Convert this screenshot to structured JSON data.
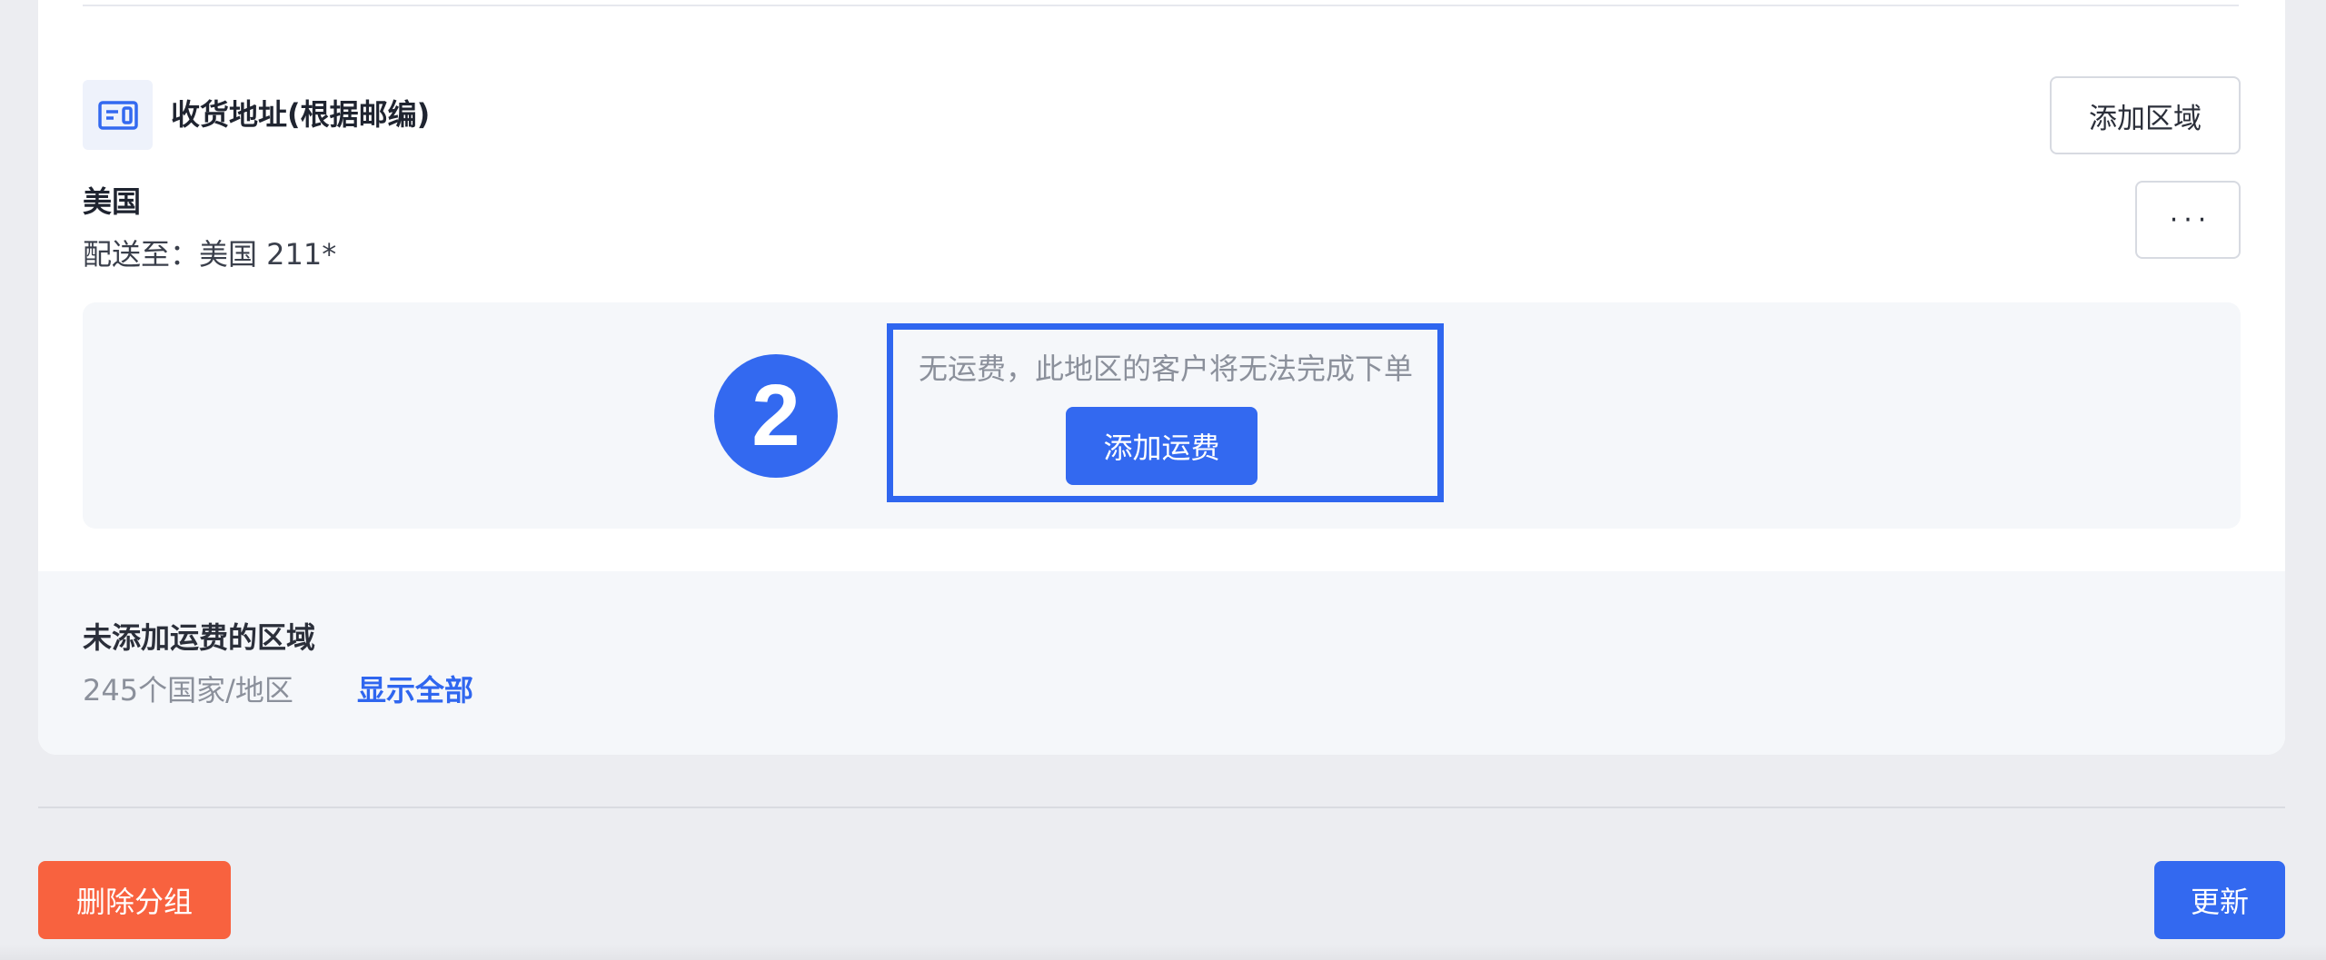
{
  "colors": {
    "primary": "#3369f0",
    "danger": "#f8623f",
    "muted_text": "#8b909b",
    "link": "#2f66ef"
  },
  "section": {
    "icon": "shipping-zone-icon",
    "title": "收货地址(根据邮编)",
    "add_region_label": "添加区域"
  },
  "zone": {
    "country": "美国",
    "ship_to": "配送至：美国 211*",
    "more_label": "···",
    "no_rate_message": "无运费，此地区的客户将无法完成下单",
    "add_rate_label": "添加运费"
  },
  "annotation": {
    "step_number": "2"
  },
  "unassigned": {
    "title": "未添加运费的区域",
    "count": "245个国家/地区",
    "show_all_label": "显示全部"
  },
  "footer": {
    "delete_label": "删除分组",
    "update_label": "更新"
  }
}
